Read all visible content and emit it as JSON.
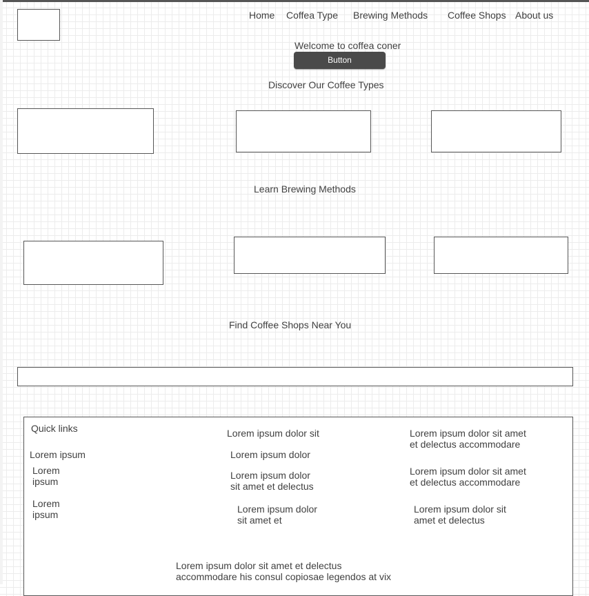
{
  "nav": {
    "items": [
      "Home",
      "Coffea Type",
      "Brewing Methods",
      "Coffee Shops",
      "About us"
    ]
  },
  "hero": {
    "welcome": "Welcome to coffea coner",
    "button_label": "Button"
  },
  "sections": {
    "coffee_types_title": "Discover Our Coffee Types",
    "brewing_title": "Learn Brewing Methods",
    "shops_title": "Find Coffee Shops Near You"
  },
  "footer": {
    "quick_links_title": "Quick links",
    "col1": [
      "Lorem ipsum",
      "Lorem ipsum",
      "Lorem ipsum"
    ],
    "col2": [
      "Lorem ipsum dolor sit",
      "Lorem ipsum dolor",
      "Lorem ipsum dolor sit amet et delectus",
      "Lorem ipsum dolor sit amet et"
    ],
    "col3": [
      "Lorem ipsum dolor sit amet et delectus accommodare",
      "Lorem ipsum dolor sit amet et delectus accommodare",
      "Lorem ipsum dolor sit amet et delectus"
    ],
    "bottom_text": "Lorem ipsum dolor sit amet et delectus accommodare his consul copiosae legendos at vix"
  },
  "colors": {
    "button_bg": "#4a4a4a",
    "text": "#404040",
    "border": "#555555"
  }
}
